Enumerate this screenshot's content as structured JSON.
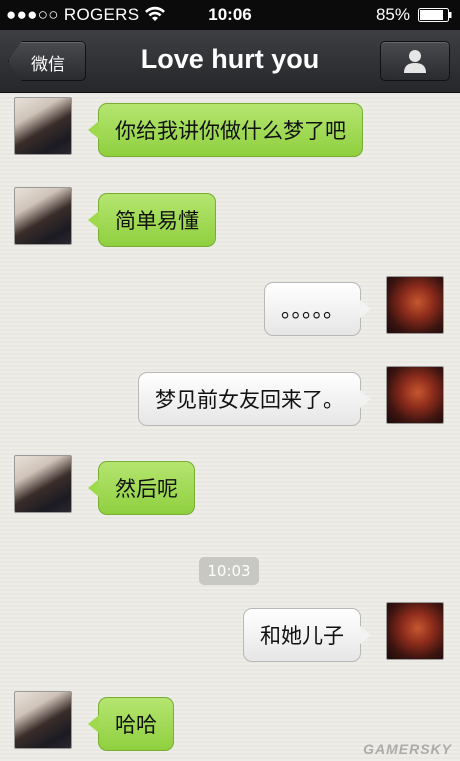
{
  "status_bar": {
    "carrier": "●●●○○ ROGERS",
    "time": "10:06",
    "battery": "85%"
  },
  "nav": {
    "back_label": "微信",
    "title": "Love hurt you",
    "profile_icon": "person-icon"
  },
  "messages": [
    {
      "from": "friend",
      "text": "你给我讲你做什么梦了吧"
    },
    {
      "from": "friend",
      "text": "简单易懂"
    },
    {
      "from": "me",
      "text": "。。。。。"
    },
    {
      "from": "me",
      "text": "梦见前女友回来了。"
    },
    {
      "from": "friend",
      "text": "然后呢"
    },
    {
      "from": "me",
      "text": "和她儿子"
    },
    {
      "from": "friend",
      "text": "哈哈"
    }
  ],
  "timestamp": "10:03",
  "watermark": "GAMERSKY",
  "colors": {
    "green_bubble": "#9fd94e",
    "white_bubble": "#f2f2f2",
    "navbar": "#2f3033"
  }
}
